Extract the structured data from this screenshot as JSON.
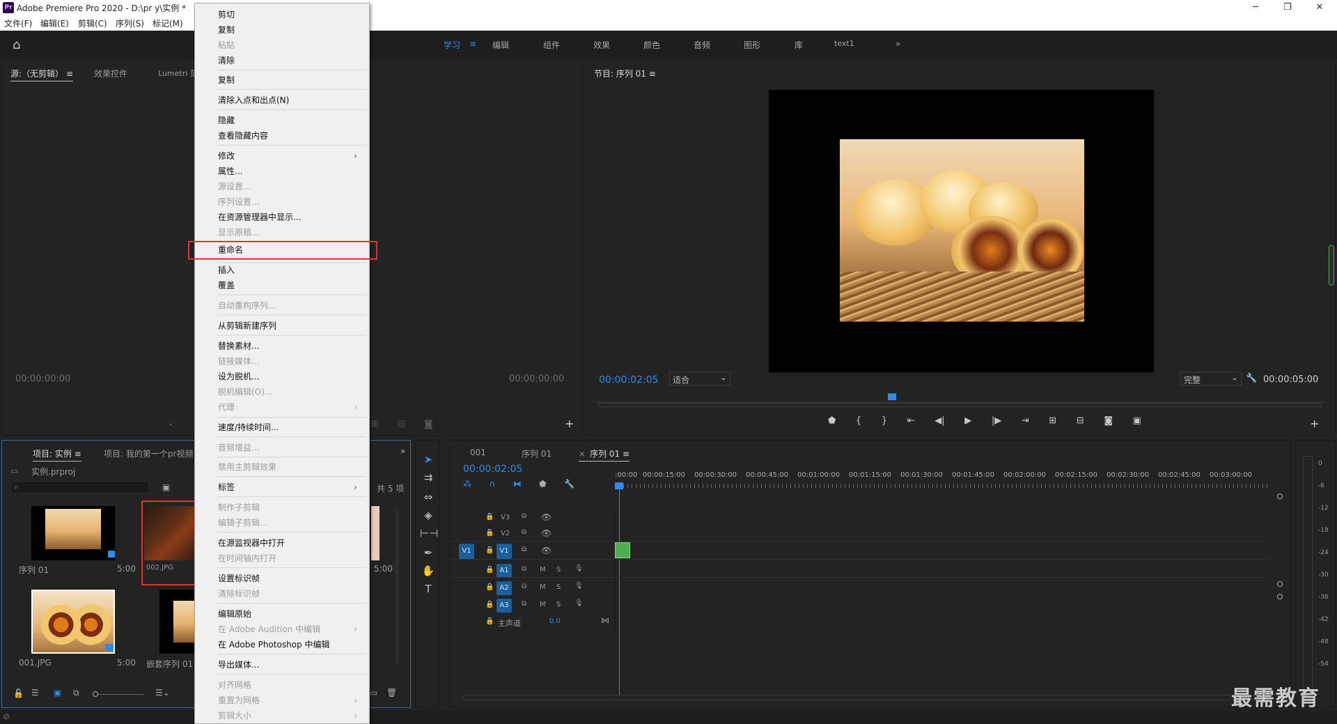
{
  "window": {
    "title": "Adobe Premiere Pro 2020 - D:\\pr y\\实例 *",
    "app_icon": "Pr"
  },
  "menubar": {
    "items": [
      "文件(F)",
      "编辑(E)",
      "剪辑(C)",
      "序列(S)",
      "标记(M)"
    ]
  },
  "workspaces": {
    "items": [
      "学习",
      "编辑",
      "组件",
      "效果",
      "颜色",
      "音频",
      "图形",
      "库",
      "text1"
    ],
    "active": "学习",
    "overflow": "»"
  },
  "source_panel": {
    "tabs": [
      "源:（无剪辑）",
      "效果控件",
      "Lumetri 范"
    ],
    "timecode_left": "00:00:00:00",
    "timecode_right": "00:00:00:00"
  },
  "program_panel": {
    "title": "节目: 序列 01",
    "timecode": "00:00:02:05",
    "fit": "适合",
    "quality": "完整",
    "duration": "00:00:05:00"
  },
  "project_panel": {
    "tabs": [
      "项目: 实例",
      "项目: 我的第一个pr视频"
    ],
    "project_file": "实例.prproj",
    "count": "共 5 项",
    "items": [
      {
        "name": "序列 01",
        "duration": "5:00"
      },
      {
        "name": "002.JPG",
        "duration": ""
      },
      {
        "name": "",
        "duration": "5:00"
      },
      {
        "name": "001.JPG",
        "duration": "5:00"
      },
      {
        "name": "嵌套序列 01",
        "duration": ""
      }
    ]
  },
  "timeline": {
    "tabs": [
      "001",
      "序列 01",
      "序列 01"
    ],
    "timecode": "00:00:02:05",
    "ruler": [
      ":00:00",
      "00:00:15:00",
      "00:00:30:00",
      "00:00:45:00",
      "00:01:00:00",
      "00:01:15:00",
      "00:01:30:00",
      "00:01:45:00",
      "00:02:00:00",
      "00:02:15:00",
      "00:02:30:00",
      "00:02:45:00",
      "00:03:00:00"
    ],
    "video_tracks": [
      "V3",
      "V2",
      "V1"
    ],
    "audio_tracks": [
      "A1",
      "A2",
      "A3"
    ],
    "src_patch": "V1",
    "master": {
      "label": "主声道",
      "value": "0.0"
    },
    "meter": [
      "0",
      "-6",
      "-12",
      "-18",
      "-24",
      "-30",
      "-36",
      "-42",
      "-48",
      "-54"
    ]
  },
  "context_menu": {
    "items": [
      {
        "label": "剪切",
        "disabled": false
      },
      {
        "label": "复制",
        "disabled": false
      },
      {
        "label": "粘贴",
        "disabled": true
      },
      {
        "label": "清除",
        "disabled": false
      },
      {
        "label": "复制",
        "disabled": false
      },
      {
        "label": "清除入点和出点(N)",
        "disabled": false
      },
      {
        "label": "隐藏",
        "disabled": false
      },
      {
        "label": "查看隐藏内容",
        "disabled": false
      },
      {
        "label": "修改",
        "disabled": false,
        "submenu": true
      },
      {
        "label": "属性...",
        "disabled": false
      },
      {
        "label": "源设置...",
        "disabled": true
      },
      {
        "label": "序列设置...",
        "disabled": true
      },
      {
        "label": "在资源管理器中显示...",
        "disabled": false
      },
      {
        "label": "显示原稿...",
        "disabled": true
      },
      {
        "label": "重命名",
        "disabled": false,
        "highlighted": true
      },
      {
        "label": "插入",
        "disabled": false
      },
      {
        "label": "覆盖",
        "disabled": false
      },
      {
        "label": "自动重构序列...",
        "disabled": true
      },
      {
        "label": "从剪辑新建序列",
        "disabled": false
      },
      {
        "label": "替换素材...",
        "disabled": false
      },
      {
        "label": "链接媒体...",
        "disabled": true
      },
      {
        "label": "设为脱机...",
        "disabled": false
      },
      {
        "label": "脱机编辑(O)...",
        "disabled": true
      },
      {
        "label": "代理",
        "disabled": true,
        "submenu": true
      },
      {
        "label": "速度/持续时间...",
        "disabled": false
      },
      {
        "label": "音频增益...",
        "disabled": true
      },
      {
        "label": "禁用主剪辑效果",
        "disabled": true
      },
      {
        "label": "标签",
        "disabled": false,
        "submenu": true
      },
      {
        "label": "制作子剪辑",
        "disabled": true
      },
      {
        "label": "编辑子剪辑...",
        "disabled": true
      },
      {
        "label": "在源监视器中打开",
        "disabled": false
      },
      {
        "label": "在时间轴内打开",
        "disabled": true
      },
      {
        "label": "设置标识帧",
        "disabled": false
      },
      {
        "label": "清除标识帧",
        "disabled": true
      },
      {
        "label": "编辑原始",
        "disabled": false
      },
      {
        "label": "在 Adobe Audition 中编辑",
        "disabled": true,
        "submenu": true
      },
      {
        "label": "在 Adobe Photoshop 中编辑",
        "disabled": false
      },
      {
        "label": "导出媒体...",
        "disabled": false
      },
      {
        "label": "对齐网格",
        "disabled": true
      },
      {
        "label": "重置为网格",
        "disabled": true,
        "submenu": true
      },
      {
        "label": "剪辑大小",
        "disabled": true,
        "submenu": true
      }
    ]
  },
  "watermark": "最需教育",
  "colors": {
    "accent": "#2d8ceb",
    "highlight": "#91c9f7",
    "red_box": "#e0332b",
    "clip_green": "#4cb050"
  }
}
